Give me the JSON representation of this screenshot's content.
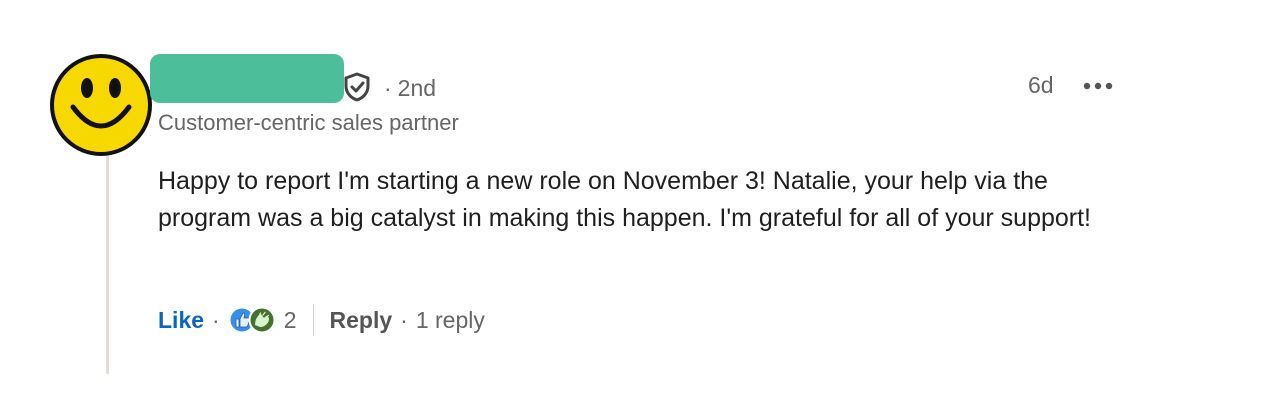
{
  "author": {
    "connection_degree": "2nd",
    "headline": "Customer-centric sales partner",
    "avatar_icon": "smiley-face-icon",
    "badge_icon": "verified-shield-icon"
  },
  "comment": {
    "time_ago": "6d",
    "text": "Happy to report I'm starting a new role on November 3! Natalie, your help via the program was a big catalyst in making this happen. I'm grateful for all of your support!"
  },
  "actions": {
    "like_label": "Like",
    "dot": "·",
    "reaction_icons": [
      "like-reaction-icon",
      "celebrate-reaction-icon"
    ],
    "reaction_count": "2",
    "reply_label": "Reply",
    "replies": "1 reply"
  },
  "colors": {
    "like_blue": "#0a66c2",
    "redaction": "#4dbe9a",
    "smiley_yellow": "#f7d800",
    "thread_line": "#e4ded6"
  }
}
